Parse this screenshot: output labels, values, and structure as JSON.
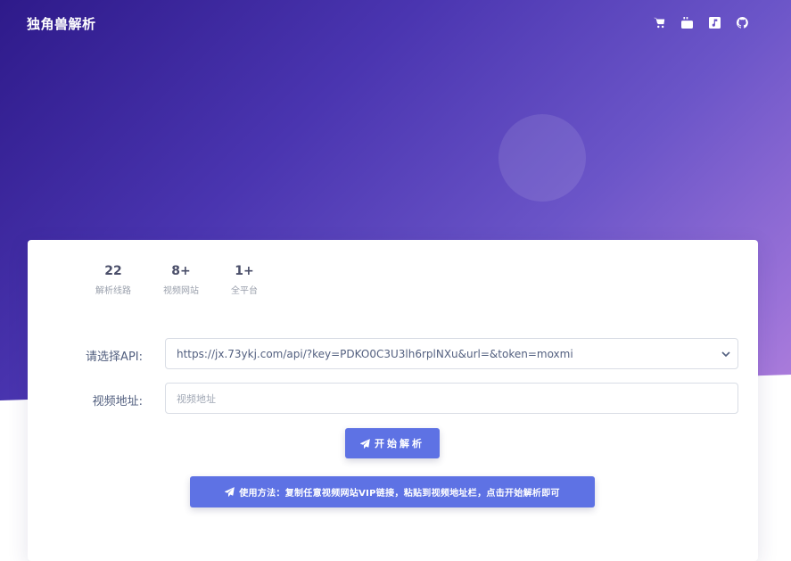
{
  "header": {
    "brand": "独角兽解析",
    "nav_icons": [
      "cart-icon",
      "youtube-icon",
      "music-icon",
      "github-icon"
    ]
  },
  "stats": [
    {
      "num": "22",
      "label": "解析线路"
    },
    {
      "num": "8+",
      "label": "视频网站"
    },
    {
      "num": "1+",
      "label": "全平台"
    }
  ],
  "form": {
    "api_label": "请选择API:",
    "api_value": "https://jx.73ykj.com/api/?key=PDKO0C3U3lh6rplNXu&url=&token=moxmi",
    "url_label": "视频地址:",
    "url_placeholder": "视频地址"
  },
  "buttons": {
    "start": "开始解析",
    "help": "使用方法：复制任意视频网站VIP链接，粘贴到视频地址栏，点击开始解析即可"
  },
  "colors": {
    "primary": "#5e72e4",
    "hero_start": "#2e1a8a",
    "hero_end": "#b07fdc"
  }
}
